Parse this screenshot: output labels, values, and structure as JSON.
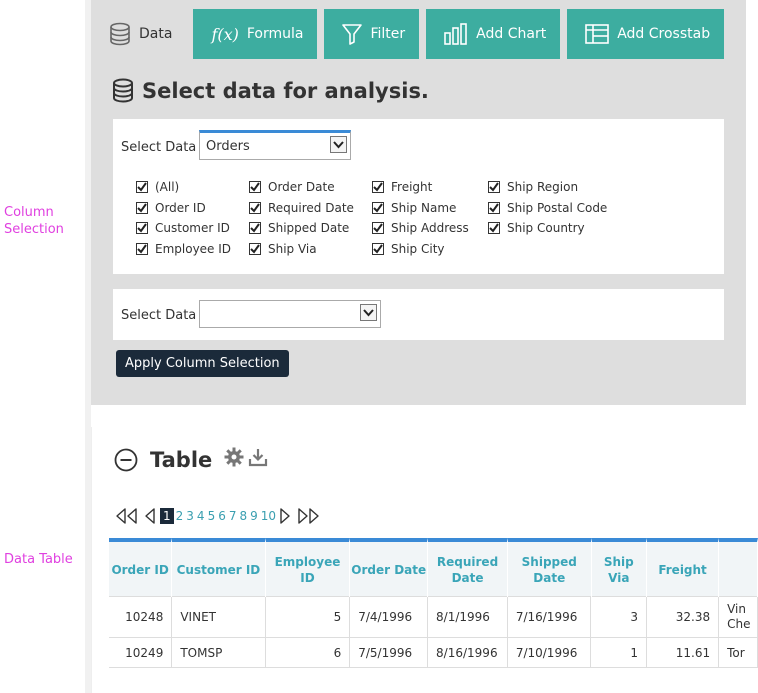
{
  "side_labels": {
    "column_selection": "Column Selection",
    "data_table": "Data Table"
  },
  "tabs": [
    {
      "label": "Data",
      "icon": "database-icon",
      "active": true
    },
    {
      "label": "Formula",
      "icon": "function-icon",
      "icon_text": "f(x)",
      "active": false
    },
    {
      "label": "Filter",
      "icon": "funnel-icon",
      "active": false
    },
    {
      "label": "Add Chart",
      "icon": "bar-chart-icon",
      "active": false
    },
    {
      "label": "Add Crosstab",
      "icon": "crosstab-icon",
      "active": false
    }
  ],
  "section": {
    "title": "Select data for analysis."
  },
  "select1": {
    "label": "Select Data",
    "value": "Orders"
  },
  "columns": [
    [
      {
        "label": "(All)",
        "checked": true
      },
      {
        "label": "Order ID",
        "checked": true
      },
      {
        "label": "Customer ID",
        "checked": true
      },
      {
        "label": "Employee ID",
        "checked": true
      }
    ],
    [
      {
        "label": "Order Date",
        "checked": true
      },
      {
        "label": "Required Date",
        "checked": true
      },
      {
        "label": "Shipped Date",
        "checked": true
      },
      {
        "label": "Ship Via",
        "checked": true
      }
    ],
    [
      {
        "label": "Freight",
        "checked": true
      },
      {
        "label": "Ship Name",
        "checked": true
      },
      {
        "label": "Ship Address",
        "checked": true
      },
      {
        "label": "Ship City",
        "checked": true
      }
    ],
    [
      {
        "label": "Ship Region",
        "checked": true
      },
      {
        "label": "Ship Postal Code",
        "checked": true
      },
      {
        "label": "Ship Country",
        "checked": true
      }
    ]
  ],
  "select2": {
    "label": "Select Data",
    "value": ""
  },
  "apply_button": "Apply Column Selection",
  "table_section": {
    "title": "Table"
  },
  "pager": {
    "pages": [
      "1",
      "2",
      "3",
      "4",
      "5",
      "6",
      "7",
      "8",
      "9",
      "10"
    ],
    "current": "1"
  },
  "table": {
    "headers": [
      "Order ID",
      "Customer ID",
      "Employee ID",
      "Order Date",
      "Required Date",
      "Shipped Date",
      "Ship Via",
      "Freight",
      ""
    ],
    "rows": [
      [
        "10248",
        "VINET",
        "5",
        "7/4/1996",
        "8/1/1996",
        "7/16/1996",
        "3",
        "32.38",
        "Vin Che"
      ],
      [
        "10249",
        "TOMSP",
        "6",
        "7/5/1996",
        "8/16/1996",
        "7/10/1996",
        "1",
        "11.61",
        "Tor"
      ]
    ]
  },
  "colors": {
    "tab_teal": "#3dada0",
    "panel_gray": "#dedede",
    "header_blue": "#3a8ad6",
    "header_text": "#3aa5b8",
    "button_dark": "#1b2a3a",
    "side_label": "#e040e0"
  }
}
